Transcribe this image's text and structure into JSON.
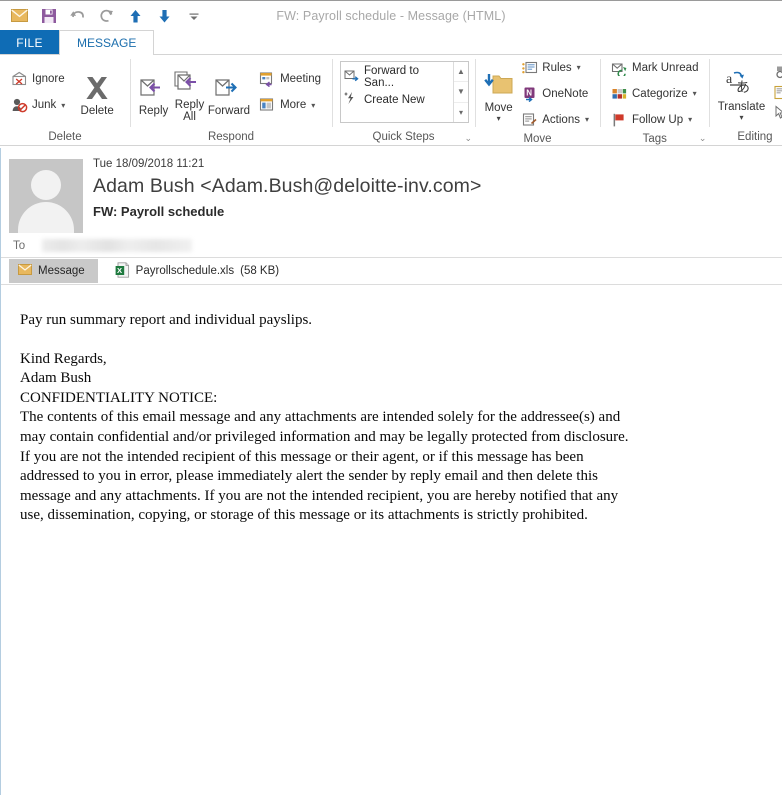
{
  "window": {
    "title": "FW: Payroll schedule  - Message (HTML)"
  },
  "quick_access_toolbar": {
    "buttons": [
      {
        "name": "mail-icon",
        "label": "Mail"
      },
      {
        "name": "save-icon",
        "label": "Save"
      },
      {
        "name": "undo-icon",
        "label": "Undo"
      },
      {
        "name": "redo-icon",
        "label": "Redo"
      },
      {
        "name": "previous-item-icon",
        "label": "Previous Item"
      },
      {
        "name": "next-item-icon",
        "label": "Next Item"
      },
      {
        "name": "customize-qat-icon",
        "label": "Customize Quick Access Toolbar"
      }
    ]
  },
  "tabs": [
    {
      "label": "FILE",
      "active": false
    },
    {
      "label": "MESSAGE",
      "active": true
    }
  ],
  "ribbon": {
    "groups": [
      {
        "label": "Delete",
        "small_buttons": [
          {
            "label": "Ignore",
            "icon": "ignore-icon",
            "caret": false
          },
          {
            "label": "Junk",
            "icon": "junk-icon",
            "caret": true
          }
        ],
        "big_buttons": [
          {
            "label": "Delete",
            "icon": "delete-x-icon",
            "caret": false
          }
        ]
      },
      {
        "label": "Respond",
        "big_buttons": [
          {
            "label": "Reply",
            "icon": "reply-icon",
            "caret": false
          },
          {
            "label": "Reply All",
            "icon": "reply-all-icon",
            "caret": false
          },
          {
            "label": "Forward",
            "icon": "forward-icon",
            "caret": false
          }
        ],
        "small_buttons": [
          {
            "label": "Meeting",
            "icon": "meeting-icon",
            "caret": false
          },
          {
            "label": "More",
            "icon": "more-icon",
            "caret": true
          }
        ]
      },
      {
        "label": "Quick Steps",
        "dialog_launcher": true,
        "gallery_items": [
          {
            "label": "Forward to San...",
            "icon": "forward-to-icon"
          },
          {
            "label": "Create New",
            "icon": "create-new-icon"
          }
        ],
        "scroll_buttons": [
          "scroll-up-icon",
          "scroll-down-icon",
          "more-options-icon"
        ]
      },
      {
        "label": "Move",
        "big_buttons": [
          {
            "label": "Move",
            "icon": "move-folder-icon",
            "caret": true
          }
        ],
        "small_buttons": [
          {
            "label": "Rules",
            "icon": "rules-icon",
            "caret": true
          },
          {
            "label": "OneNote",
            "icon": "onenote-icon",
            "caret": false
          },
          {
            "label": "Actions",
            "icon": "actions-icon",
            "caret": true
          }
        ]
      },
      {
        "label": "Tags",
        "dialog_launcher": true,
        "small_buttons": [
          {
            "label": "Mark Unread",
            "icon": "mark-unread-icon",
            "caret": false
          },
          {
            "label": "Categorize",
            "icon": "categorize-icon",
            "caret": true
          },
          {
            "label": "Follow Up",
            "icon": "follow-up-flag-icon",
            "caret": true
          }
        ]
      },
      {
        "label": "Editing",
        "big_buttons": [
          {
            "label": "Translate",
            "icon": "translate-icon",
            "caret": true
          }
        ],
        "small_buttons": [
          {
            "label": "",
            "icon": "find-icon",
            "caret": false
          },
          {
            "label": "",
            "icon": "related-icon",
            "caret": false
          },
          {
            "label": "",
            "icon": "select-icon",
            "caret": false
          }
        ]
      }
    ]
  },
  "message": {
    "date": "Tue 18/09/2018 11:21",
    "from": "Adam Bush <Adam.Bush@deloitte-inv.com>",
    "subject": "FW: Payroll schedule",
    "to_label": "To",
    "to_value_redacted": true,
    "message_tab_label": "Message",
    "attachment": {
      "filename": "Payrollschedule.xls",
      "size": "(58 KB)",
      "icon": "excel-file-icon"
    },
    "body": {
      "intro": "Pay run summary report and individual payslips.",
      "signoff_line1": "Kind Regards,",
      "signoff_line2": "Adam Bush",
      "notice_heading": "CONFIDENTIALITY NOTICE:",
      "notice_text": "The contents of this email message and any attachments are intended solely for the addressee(s) and may contain confidential and/or privileged information and may be legally protected from disclosure. If you are not the intended recipient of this message or their agent, or if this message has been addressed to you in error, please immediately alert the sender by reply email and then delete this message and any attachments. If you are not the intended recipient, you are hereby notified that any use, dissemination, copying, or storage of this message or its attachments is strictly prohibited."
    }
  },
  "colors": {
    "file_tab_blue": "#0f6cb5",
    "tab_text_blue": "#1b6ead",
    "mail_icon_orange": "#e8b85e",
    "save_icon_purple": "#8e5a9e",
    "nav_arrow_blue": "#1f6fb5",
    "excel_green": "#1f7a3f",
    "avatar_gray": "#c6c6c6",
    "attachment_tab_gray": "#c9c9c9",
    "flag_red": "#cf3a2a"
  }
}
